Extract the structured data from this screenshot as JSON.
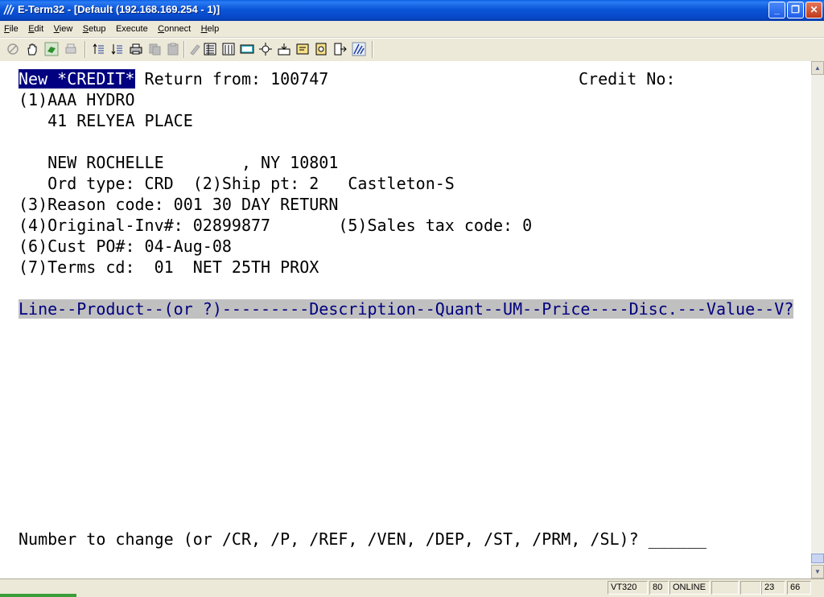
{
  "window": {
    "title": "E-Term32 - [Default (192.168.169.254 - 1)]",
    "controls": {
      "minimize": "_",
      "restore": "❐",
      "close": "✕"
    }
  },
  "menu": [
    {
      "first": "F",
      "rest": "ile"
    },
    {
      "first": "E",
      "rest": "dit"
    },
    {
      "first": "V",
      "rest": "iew"
    },
    {
      "first": "S",
      "rest": "etup"
    },
    {
      "first": "",
      "rest": "Execute"
    },
    {
      "first": "C",
      "rest": "onnect"
    },
    {
      "first": "H",
      "rest": "elp"
    }
  ],
  "toolbar": {
    "icons": [
      "disconnect-icon",
      "hand-icon",
      "connect-icon",
      "print-disabled-icon",
      "upload-icon",
      "download-icon",
      "printer-icon",
      "copy-disabled-icon",
      "paste-disabled-icon",
      "edit-disabled-icon",
      "properties-icon",
      "session-icon",
      "keypad-icon",
      "network-icon",
      "capture-icon",
      "macro-icon",
      "script-icon",
      "exit-icon",
      "settings-icon"
    ]
  },
  "terminal": {
    "header_highlight": "New *CREDIT*",
    "header_rest": " Return from: 100747",
    "credit_no": "Credit No:",
    "line2": "(1)AAA HYDRO",
    "line3": "   41 RELYEA PLACE",
    "line5": "   NEW ROCHELLE        , NY 10801",
    "line6": "   Ord type: CRD  (2)Ship pt: 2   Castleton-S",
    "line7": "(3)Reason code: 001 30 DAY RETURN",
    "line8": "(4)Original-Inv#: 02899877       (5)Sales tax code: 0",
    "line9": "(6)Cust PO#: 04-Aug-08",
    "line10": "(7)Terms cd:  01  NET 25TH PROX",
    "columns_header": "Line--Product--(or ?)---------Description--Quant--UM--Price----Disc.---Value--V?",
    "prompt": "Number to change (or /CR, /P, /REF, /VEN, /DEP, /ST, /PRM, /SL)? ______"
  },
  "status": {
    "emulation": "VT320",
    "columns": "80",
    "state": "ONLINE",
    "row": "23",
    "col": "66"
  }
}
